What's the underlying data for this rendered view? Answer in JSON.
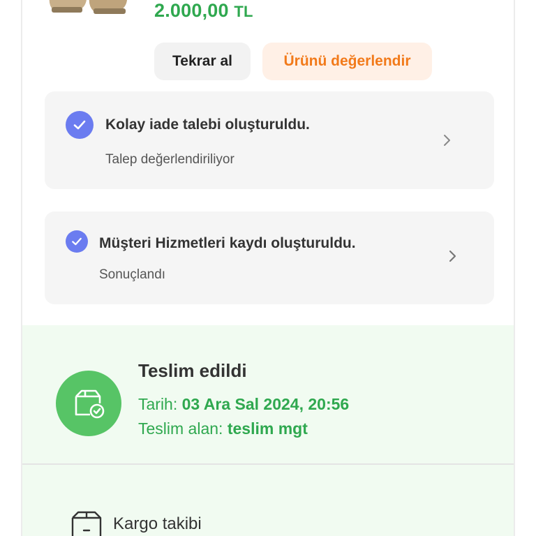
{
  "product": {
    "price_value": "2.000,00",
    "price_currency": "TL"
  },
  "actions": {
    "rebuy_label": "Tekrar al",
    "rate_label": "Ürünü değerlendir"
  },
  "status_cards": [
    {
      "title": "Kolay iade talebi oluşturuldu.",
      "subtitle": "Talep değerlendiriliyor"
    },
    {
      "title": "Müşteri Hizmetleri kaydı oluşturuldu.",
      "subtitle": "Sonuçlandı"
    }
  ],
  "delivery": {
    "title": "Teslim edildi",
    "date_label": "Tarih:",
    "date_value": "03 Ara Sal 2024, 20:56",
    "receiver_label": "Teslim alan:",
    "receiver_value": "teslim mgt"
  },
  "cargo": {
    "label": "Kargo takibi"
  },
  "colors": {
    "price_green": "#2fa84f",
    "accent_orange": "#f27a1a",
    "check_blue": "#6b7cf0",
    "delivered_bg": "#f1fbf1"
  },
  "icons": [
    "checkmark-icon",
    "chevron-right-icon",
    "package-delivered-icon",
    "package-icon"
  ]
}
